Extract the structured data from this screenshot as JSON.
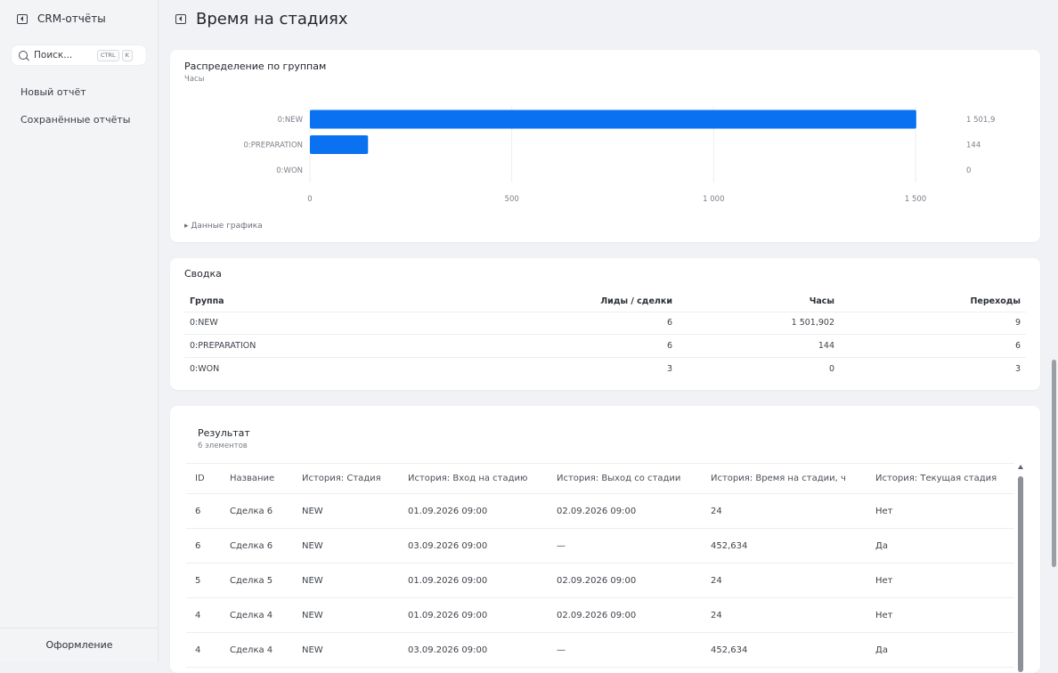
{
  "sidebar": {
    "title": "CRM-отчёты",
    "search_placeholder": "Поиск...",
    "kbd_ctrl": "CTRL",
    "kbd_k": "K",
    "items": [
      {
        "label": "Новый отчёт"
      },
      {
        "label": "Сохранённые отчёты"
      }
    ],
    "footer": "Оформление"
  },
  "page": {
    "title": "Время на стадиях"
  },
  "distribution": {
    "title": "Распределение по группам",
    "subtitle": "Часы",
    "toggle": "▸ Данные графика"
  },
  "chart_data": {
    "type": "bar",
    "orientation": "horizontal",
    "title": "Распределение по группам",
    "subtitle": "Часы",
    "categories": [
      "0:NEW",
      "0:PREPARATION",
      "0:WON"
    ],
    "values": [
      1501.9,
      144,
      0
    ],
    "value_labels": [
      "1 501,9",
      "144",
      "0"
    ],
    "xlim": [
      0,
      1500
    ],
    "xticks": [
      0,
      500,
      1000,
      1500
    ],
    "xtick_labels": [
      "0",
      "500",
      "1 000",
      "1 500"
    ],
    "grid": true,
    "bar_color": "#0a72f0"
  },
  "summary": {
    "title": "Сводка",
    "columns": [
      "Группа",
      "Лиды / сделки",
      "Часы",
      "Переходы"
    ],
    "rows": [
      [
        "0:NEW",
        "6",
        "1 501,902",
        "9"
      ],
      [
        "0:PREPARATION",
        "6",
        "144",
        "6"
      ],
      [
        "0:WON",
        "3",
        "0",
        "3"
      ]
    ]
  },
  "result": {
    "title": "Результат",
    "count": "6 элементов",
    "columns": [
      "ID",
      "Название",
      "История: Стадия",
      "История: Вход на стадию",
      "История: Выход со стадии",
      "История: Время на стадии, ч",
      "История: Текущая стадия"
    ],
    "rows": [
      [
        "6",
        "Сделка 6",
        "NEW",
        "01.09.2026 09:00",
        "02.09.2026 09:00",
        "24",
        "Нет"
      ],
      [
        "6",
        "Сделка 6",
        "NEW",
        "03.09.2026 09:00",
        "—",
        "452,634",
        "Да"
      ],
      [
        "5",
        "Сделка 5",
        "NEW",
        "01.09.2026 09:00",
        "02.09.2026 09:00",
        "24",
        "Нет"
      ],
      [
        "4",
        "Сделка 4",
        "NEW",
        "01.09.2026 09:00",
        "02.09.2026 09:00",
        "24",
        "Нет"
      ],
      [
        "4",
        "Сделка 4",
        "NEW",
        "03.09.2026 09:00",
        "—",
        "452,634",
        "Да"
      ]
    ]
  }
}
